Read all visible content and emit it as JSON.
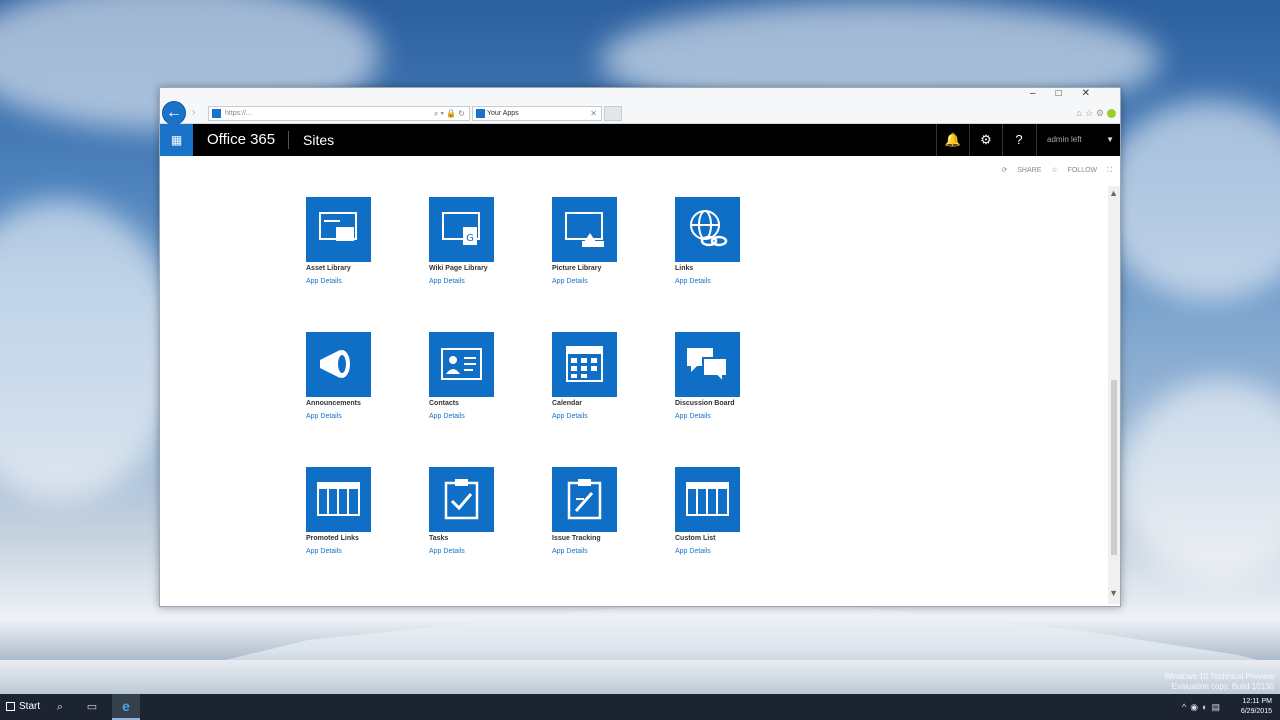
{
  "desktop": {
    "watermark": [
      "Windows 10 Technical Preview",
      "Evaluation copy. Build 10130"
    ]
  },
  "browser": {
    "address_text": "https://...",
    "tab_title": "Your Apps",
    "window_controls": [
      "–",
      "□",
      "✕"
    ]
  },
  "suitebar": {
    "brand": "Office 365",
    "section": "Sites",
    "user_name": "admin left"
  },
  "cmdbar": {
    "share": "SHARE",
    "follow": "FOLLOW"
  },
  "apps": [
    {
      "name": "Asset Library",
      "details": "App Details",
      "icon": "asset-library-icon"
    },
    {
      "name": "Wiki Page Library",
      "details": "App Details",
      "icon": "wiki-page-library-icon"
    },
    {
      "name": "Picture Library",
      "details": "App Details",
      "icon": "picture-library-icon"
    },
    {
      "name": "Links",
      "details": "App Details",
      "icon": "links-icon"
    },
    {
      "name": "Announcements",
      "details": "App Details",
      "icon": "announcements-icon"
    },
    {
      "name": "Contacts",
      "details": "App Details",
      "icon": "contacts-icon"
    },
    {
      "name": "Calendar",
      "details": "App Details",
      "icon": "calendar-icon"
    },
    {
      "name": "Discussion Board",
      "details": "App Details",
      "icon": "discussion-board-icon"
    },
    {
      "name": "Promoted Links",
      "details": "App Details",
      "icon": "promoted-links-icon"
    },
    {
      "name": "Tasks",
      "details": "App Details",
      "icon": "tasks-icon"
    },
    {
      "name": "Issue Tracking",
      "details": "App Details",
      "icon": "issue-tracking-icon"
    },
    {
      "name": "Custom List",
      "details": "App Details",
      "icon": "custom-list-icon"
    }
  ],
  "taskbar": {
    "start_label": "Start",
    "time": "12:11 PM",
    "date": "6/29/2015"
  },
  "colors": {
    "accent": "#0f6fc6",
    "suitebar": "#000000",
    "waffle": "#1a73c8"
  }
}
